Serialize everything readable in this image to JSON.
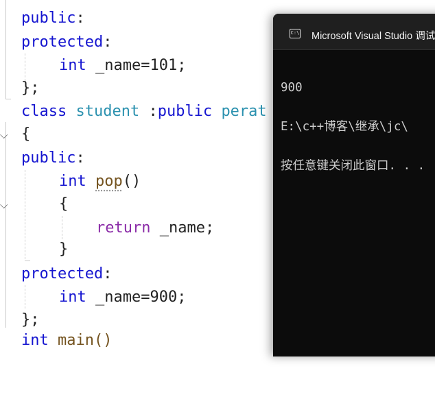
{
  "editor": {
    "lines": {
      "l1": {
        "kw": "public",
        "punct": ":"
      },
      "l2": {
        "kw": "protected",
        "punct": ":"
      },
      "l3": {
        "type": "int",
        "rest": " _name=101;"
      },
      "l4": {
        "text": "};"
      },
      "l5": {
        "kw": "class",
        "classname": "student",
        "sep": " :",
        "kw2": "public",
        "base": "perat"
      },
      "l6": {
        "text": "{"
      },
      "l7": {
        "kw": "public",
        "punct": ":"
      },
      "l8": {
        "type": "int",
        "fn": "pop",
        "rest": "()"
      },
      "l9": {
        "text": "{"
      },
      "l10": {
        "kw": "return",
        "rest": " _name;"
      },
      "l11": {
        "text": "}"
      },
      "l12": {
        "kw": "protected",
        "punct": ":"
      },
      "l13": {
        "type": "int",
        "rest": " _name=900;"
      },
      "l14": {
        "text": "};"
      },
      "l15": {
        "type": "int",
        "rest": "main()"
      }
    },
    "fold_glyph": "⌵"
  },
  "console": {
    "title": "Microsoft Visual Studio 调试控制台",
    "icon_label": "C:\\",
    "output": [
      "900",
      "E:\\c++博客\\继承\\jc\\",
      "按任意键关闭此窗口. . ."
    ]
  },
  "colors": {
    "keyword": "#1515d0",
    "control_keyword": "#8b2ca8",
    "class_name": "#2b91af",
    "function_name": "#74531f",
    "console_bg": "#0c0c0c",
    "console_text": "#cccccc"
  }
}
